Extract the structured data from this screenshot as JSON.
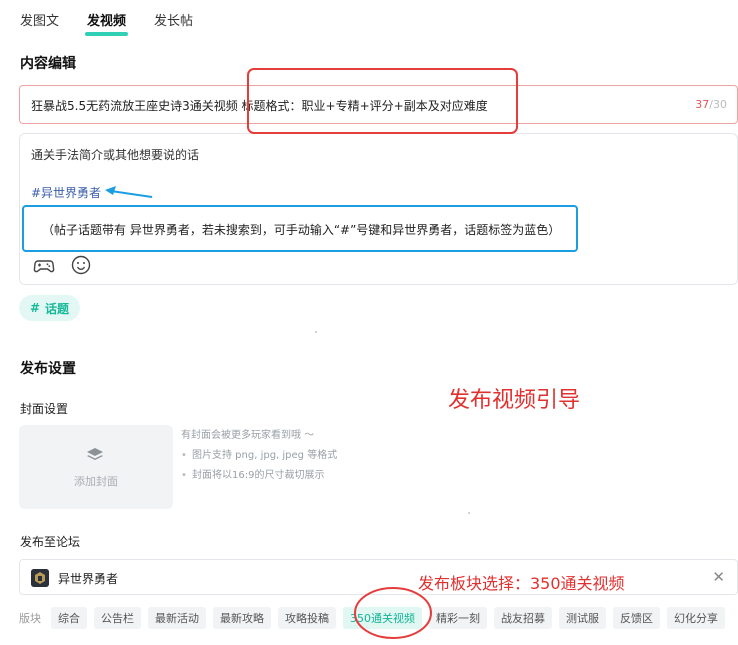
{
  "tabs": [
    {
      "label": "发图文",
      "active": false
    },
    {
      "label": "发视频",
      "active": true
    },
    {
      "label": "发长帖",
      "active": false
    }
  ],
  "content_editing": {
    "title": "内容编辑",
    "title_value": "狂暴战5.5无药流放王座史诗3通关视频 标题格式：职业+专精+评分+副本及对应难度",
    "counter_current": "37",
    "counter_max": "/30",
    "body_placeholder": "通关手法简介或其他想要说的话",
    "hashtag": "#异世界勇者",
    "toolbar_icons": [
      "gamepad-icon",
      "emoji-icon"
    ]
  },
  "topic_button": {
    "icon": "#",
    "label": "话题"
  },
  "publish_settings": {
    "title": "发布设置",
    "cover_title": "封面设置",
    "cover_button_label": "添加封面",
    "cover_tips_heading": "有封面会被更多玩家看到哦 ～",
    "cover_tips": [
      "图片支持 png, jpg, jpeg 等格式",
      "封面将以16:9的尺寸裁切展示"
    ],
    "forum_title": "发布至论坛",
    "forum_name": "异世界勇者",
    "board_label": "版块",
    "boards": [
      {
        "label": "综合",
        "active": false
      },
      {
        "label": "公告栏",
        "active": false
      },
      {
        "label": "最新活动",
        "active": false
      },
      {
        "label": "最新攻略",
        "active": false
      },
      {
        "label": "攻略投稿",
        "active": false
      },
      {
        "label": "350通关视频",
        "active": true
      },
      {
        "label": "精彩一刻",
        "active": false
      },
      {
        "label": "战友招募",
        "active": false
      },
      {
        "label": "测试服",
        "active": false
      },
      {
        "label": "反馈区",
        "active": false
      },
      {
        "label": "幻化分享",
        "active": false
      }
    ]
  },
  "annotations": {
    "topic_note": "（帖子话题带有 异世界勇者，若未搜索到，可手动输入“#”号键和异世界勇者，话题标签为蓝色）",
    "guide_title": "发布视频引导",
    "board_note": "发布板块选择：350通关视频"
  },
  "colors": {
    "accent": "#2fd0b6",
    "annotation_red": "#e0312f",
    "annotation_blue": "#1b9de2",
    "hashtag_blue": "#3a5ea8"
  }
}
